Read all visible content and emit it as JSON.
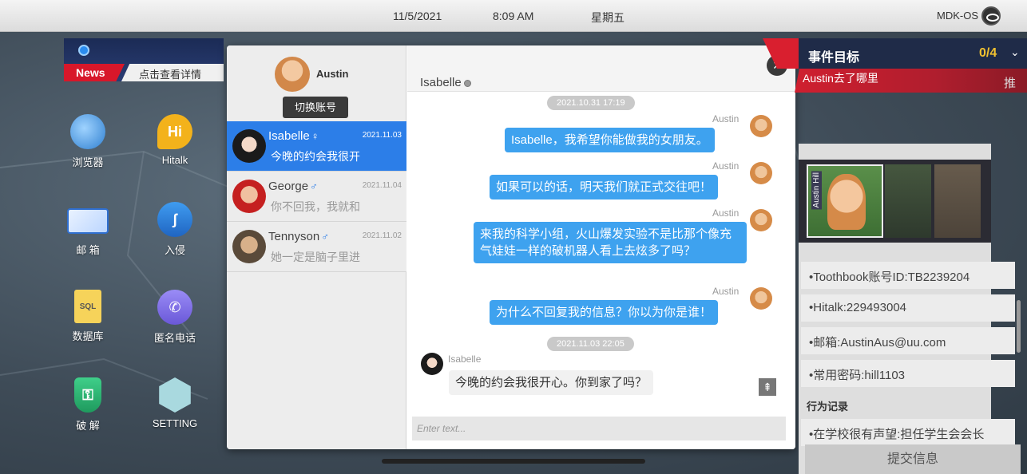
{
  "statusbar": {
    "date": "11/5/2021",
    "time": "8:09 AM",
    "weekday": "星期五",
    "os": "MDK-OS"
  },
  "news": {
    "tag": "News",
    "link": "点击查看详情"
  },
  "desktop": {
    "apps": [
      {
        "label": "浏览器",
        "icon": "globe-icon"
      },
      {
        "label": "Hitalk",
        "icon": "hi-chat-icon"
      },
      {
        "label": "邮 箱",
        "icon": "mail-icon"
      },
      {
        "label": "入侵",
        "icon": "hook-icon"
      },
      {
        "label": "数据库",
        "icon": "sql-file-icon"
      },
      {
        "label": "匿名电话",
        "icon": "phone-icon"
      },
      {
        "label": "破 解",
        "icon": "shield-key-icon"
      },
      {
        "label": "SETTING",
        "icon": "hexagon-gear-icon"
      }
    ],
    "hi_glyph": "Hi",
    "sql_glyph": "SQL"
  },
  "chat": {
    "me": {
      "name": "Austin"
    },
    "switch_account": "切换账号",
    "contacts": [
      {
        "name": "Isabelle",
        "gender": "♀",
        "date": "2021.11.03",
        "preview": "今晚的约会我很开",
        "active": true
      },
      {
        "name": "George",
        "gender": "♂",
        "date": "2021.11.04",
        "preview": "你不回我，我就和",
        "active": false
      },
      {
        "name": "Tennyson",
        "gender": "♂",
        "date": "2021.11.02",
        "preview": "她一定是脑子里进",
        "active": false
      }
    ],
    "conversation": {
      "title": "Isabelle",
      "close": "×",
      "stamps": [
        "2021.10.31  17:19",
        "2021.11.03  22:05"
      ],
      "messages": [
        {
          "sender": "Austin",
          "text": "Isabelle，我希望你能做我的女朋友。",
          "direction": "out"
        },
        {
          "sender": "Austin",
          "text": "如果可以的话，明天我们就正式交往吧！",
          "direction": "out"
        },
        {
          "sender": "Austin",
          "text": "来我的科学小组，火山爆发实验不是比那个像充气娃娃一样的破机器人看上去炫多了吗？",
          "direction": "out"
        },
        {
          "sender": "Austin",
          "text": "为什么不回复我的信息？你以为你是谁！",
          "direction": "out"
        },
        {
          "sender": "Isabelle",
          "text": "今晚的约会我很开心。你到家了吗？",
          "direction": "in"
        }
      ],
      "input_placeholder": "Enter text...",
      "scroll_top_glyph": "⇞"
    }
  },
  "objective": {
    "title": "事件目标",
    "count": "0/4",
    "chevron": "⌄",
    "task": "Austin去了哪里",
    "reason_button": "推理›",
    "profile_card_name": "Austin Hill",
    "info": [
      "•Toothbook账号ID:TB2239204",
      "•Hitalk:229493004",
      "•邮箱:AustinAus@uu.com",
      "•常用密码:hill1103"
    ],
    "section": "行为记录",
    "records": [
      "•在学校很有声望:担任学生会会长"
    ],
    "submit": "提交信息"
  }
}
